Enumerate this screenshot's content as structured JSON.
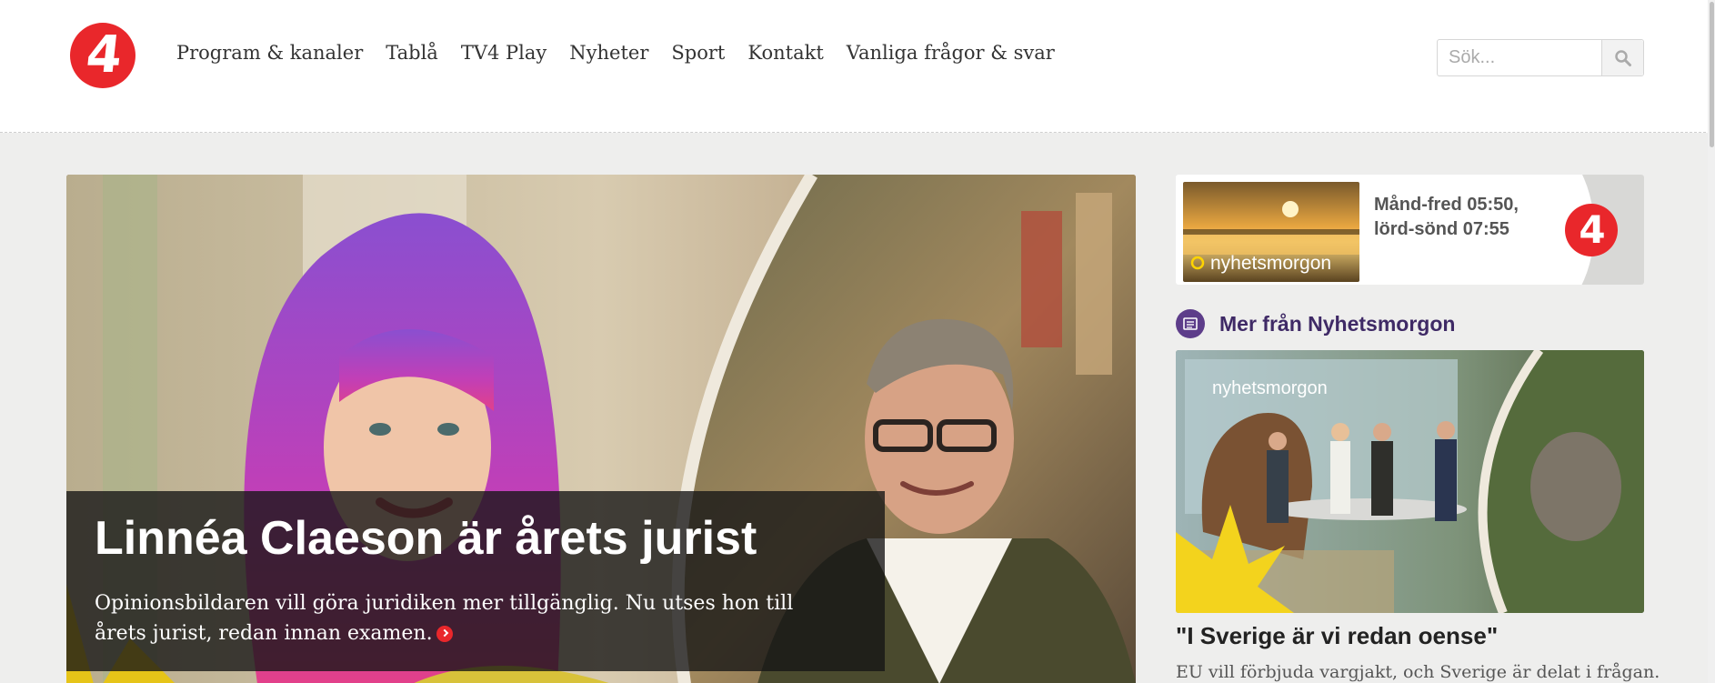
{
  "header": {
    "logo_text": "4",
    "nav": [
      {
        "label": "Program & kanaler"
      },
      {
        "label": "Tablå"
      },
      {
        "label": "TV4 Play"
      },
      {
        "label": "Nyheter"
      },
      {
        "label": "Sport"
      },
      {
        "label": "Kontakt"
      },
      {
        "label": "Vanliga frågor & svar"
      }
    ],
    "search": {
      "placeholder": "Sök...",
      "value": ""
    }
  },
  "hero": {
    "title": "Linnéa Claeson är årets jurist",
    "text": "Opinionsbildaren vill göra juridiken mer tillgänglig. Nu utses hon till årets jurist, redan innan examen."
  },
  "promo": {
    "brand": "nyhetsmorgon",
    "schedule": "Månd-fred 05:50, lörd-sönd 07:55",
    "logo_text": "4"
  },
  "more": {
    "heading": "Mer från Nyhetsmorgon",
    "card": {
      "studio_brand": "nyhetsmorgon",
      "title": "\"I Sverige är vi redan oense\"",
      "text": "EU vill förbjuda vargjakt, och Sverige är delat i frågan."
    }
  },
  "colors": {
    "brand_red": "#e9272b",
    "accent_purple": "#5d3d8a",
    "page_bg": "#eeeeed"
  }
}
